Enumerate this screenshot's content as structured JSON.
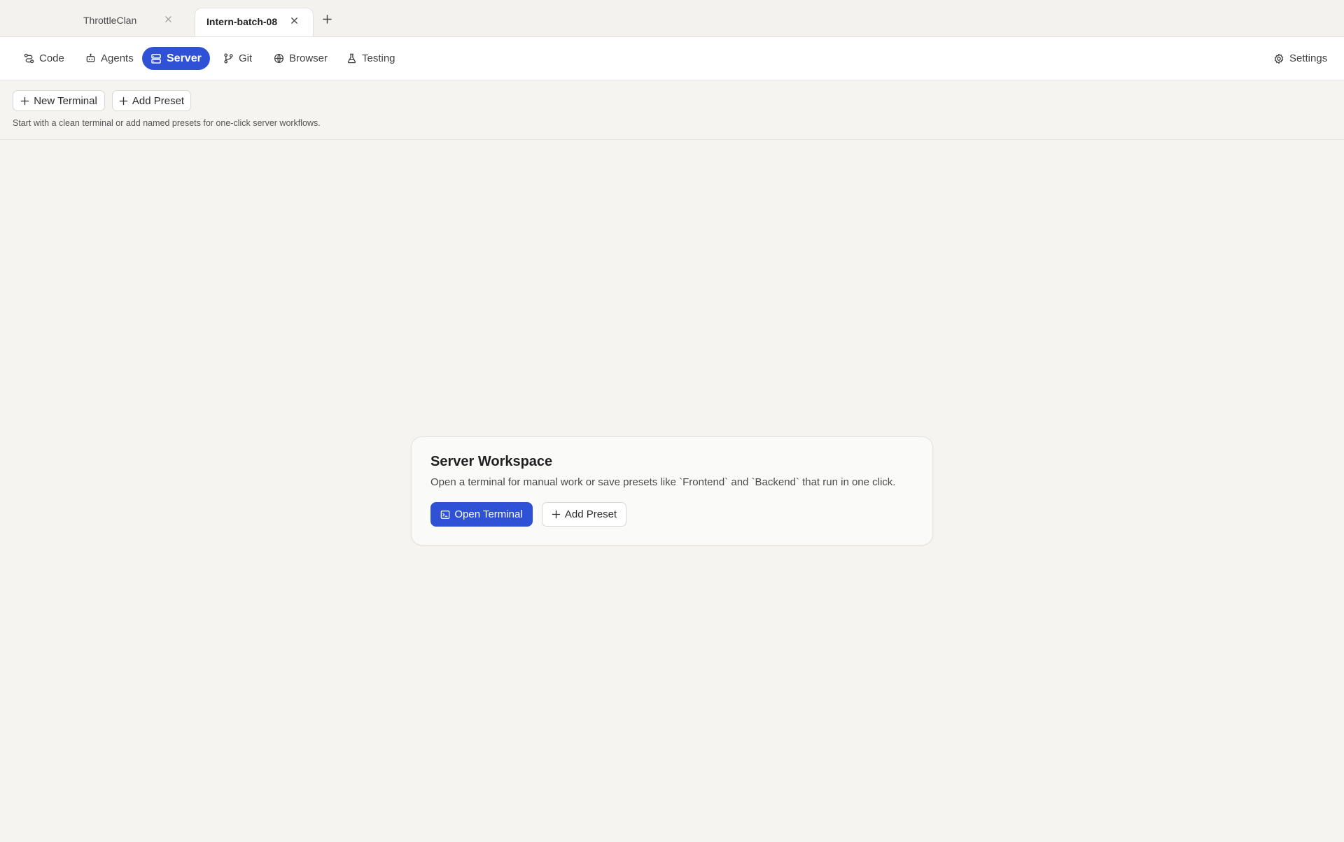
{
  "tabs": [
    {
      "label": "ThrottleClan",
      "active": false
    },
    {
      "label": "Intern-batch-08",
      "active": true
    }
  ],
  "nav": {
    "items": [
      {
        "label": "Code",
        "icon": "route-icon"
      },
      {
        "label": "Agents",
        "icon": "robot-icon"
      },
      {
        "label": "Server",
        "icon": "server-icon",
        "active": true
      },
      {
        "label": "Git",
        "icon": "git-branch-icon"
      },
      {
        "label": "Browser",
        "icon": "globe-icon"
      },
      {
        "label": "Testing",
        "icon": "flask-icon"
      }
    ],
    "settings_label": "Settings"
  },
  "toolbar": {
    "new_terminal_label": "New Terminal",
    "add_preset_label": "Add Preset",
    "hint": "Start with a clean terminal or add named presets for one-click server workflows."
  },
  "workspace": {
    "title": "Server Workspace",
    "description": "Open a terminal for manual work or save presets like `Frontend` and `Backend` that run in one click.",
    "open_terminal_label": "Open Terminal",
    "add_preset_label": "Add Preset"
  },
  "colors": {
    "accent": "#2f51d6",
    "background": "#f5f4f1",
    "surface": "#ffffff"
  }
}
